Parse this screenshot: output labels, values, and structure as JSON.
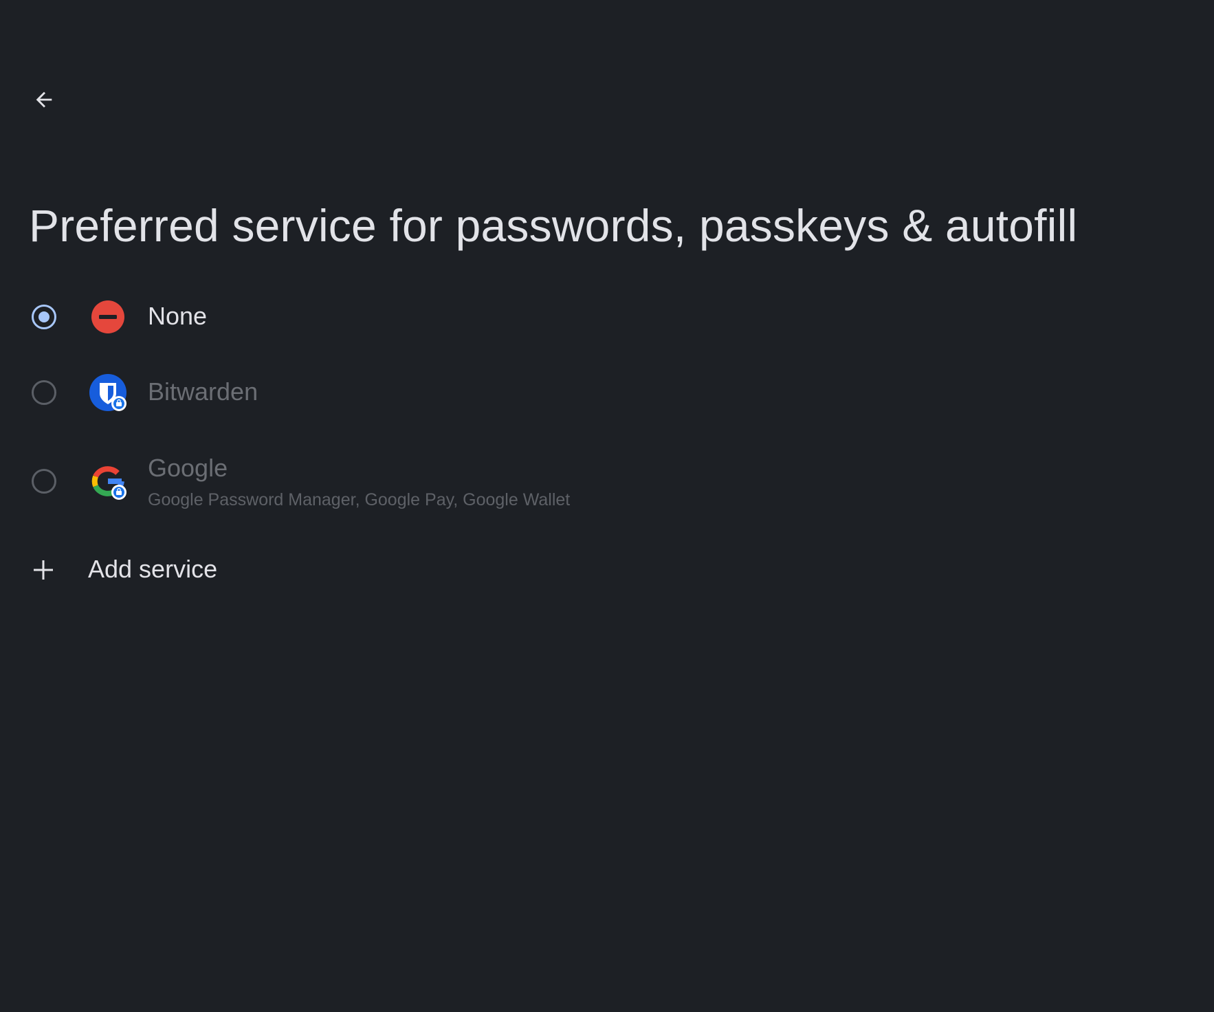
{
  "header": {
    "back_icon": "arrow-back-icon"
  },
  "page": {
    "title": "Preferred service for passwords, passkeys & autofill"
  },
  "options": [
    {
      "label": "None",
      "subtitle": "",
      "selected": true,
      "enabled": true,
      "icon": "none-minus-icon",
      "icon_color": "#e5473c"
    },
    {
      "label": "Bitwarden",
      "subtitle": "",
      "selected": false,
      "enabled": false,
      "icon": "bitwarden-shield-icon",
      "icon_color": "#175ddc"
    },
    {
      "label": "Google",
      "subtitle": "Google Password Manager, Google Pay, Google Wallet",
      "selected": false,
      "enabled": false,
      "icon": "google-g-icon",
      "icon_color": "#4285f4"
    }
  ],
  "add_service": {
    "label": "Add service",
    "icon": "plus-icon"
  },
  "colors": {
    "background": "#1d2025",
    "accent": "#a8c7fa",
    "text_primary": "#e3e3e8",
    "text_disabled": "#6b6e74"
  }
}
